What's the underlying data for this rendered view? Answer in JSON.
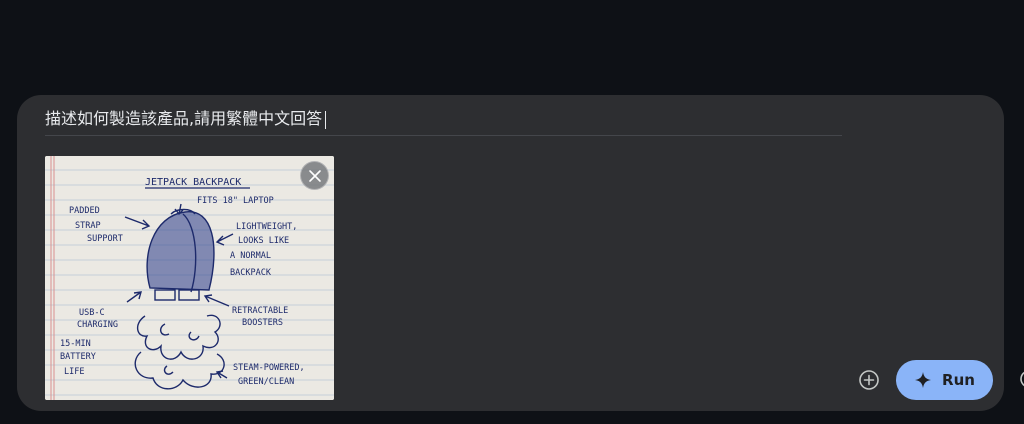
{
  "prompt": {
    "text": "描述如何製造該產品,請用繁體中文回答"
  },
  "attachment": {
    "title": "JETPACK BACKPACK",
    "labels": {
      "fits": "FITS 18\" LAPTOP",
      "padded_1": "PADDED",
      "padded_2": "STRAP",
      "padded_3": "SUPPORT",
      "light_1": "LIGHTWEIGHT,",
      "light_2": "LOOKS LIKE",
      "light_3": "A NORMAL",
      "light_4": "BACKPACK",
      "usb_1": "USB-C",
      "usb_2": "CHARGING",
      "retract_1": "RETRACTABLE",
      "retract_2": "BOOSTERS",
      "battery_1": "15-MIN",
      "battery_2": "BATTERY",
      "battery_3": "LIFE",
      "steam_1": "STEAM-POWERED,",
      "steam_2": "GREEN/CLEAN"
    },
    "remove_icon": "close-icon"
  },
  "actions": {
    "add_icon": "add-circle-icon",
    "run_label": "Run",
    "run_icon": "sparkle-icon"
  },
  "colors": {
    "page_bg": "#0e1116",
    "card_bg": "#2d2e31",
    "run_bg": "#8ab4f8",
    "ink": "#1d2a6b"
  }
}
